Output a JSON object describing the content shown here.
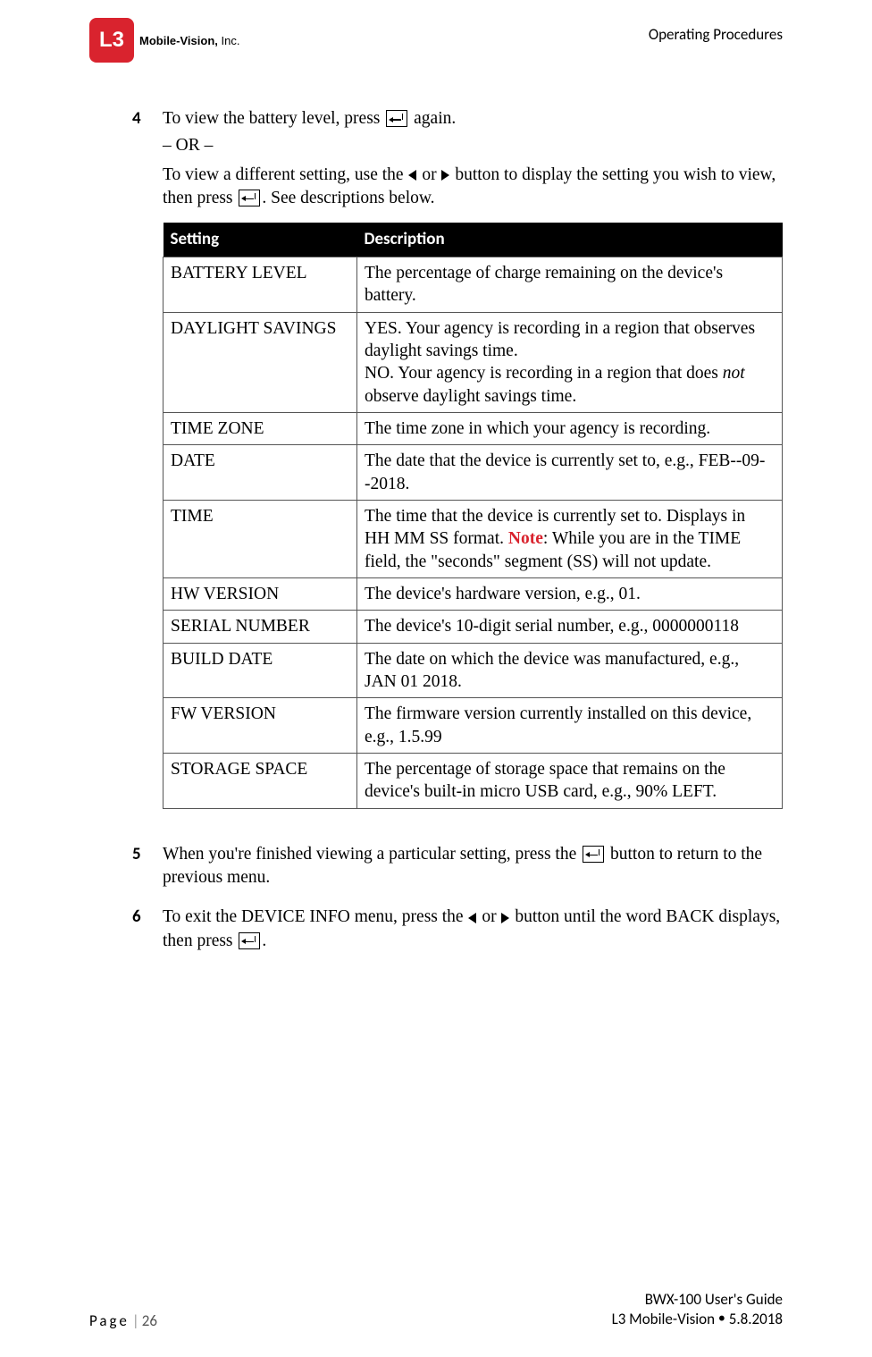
{
  "header": {
    "logo_badge": "L3",
    "logo_company_bold": "Mobile-Vision,",
    "logo_company_sfx": " Inc.",
    "section_title": "Operating Procedures"
  },
  "steps": {
    "s4": {
      "num": "4",
      "line1_a": "To view the battery level, press ",
      "line1_b": " again.",
      "or": "– OR –",
      "line2_a": "To view a different setting, use the ",
      "line2_mid": " or ",
      "line2_b": " button to display the setting you wish to view, then press ",
      "line2_c": ". See descriptions below."
    },
    "s5": {
      "num": "5",
      "text_a": "When you're finished viewing a particular setting, press the ",
      "text_b": " button to return to the previous menu."
    },
    "s6": {
      "num": "6",
      "text_a": "To exit the DEVICE INFO menu, press the ",
      "text_mid": " or ",
      "text_b": " button until the word BACK displays, then press ",
      "text_c": "."
    }
  },
  "table": {
    "col1": "Setting",
    "col2": "Description",
    "rows": [
      {
        "setting": "BATTERY LEVEL",
        "desc_plain": "The percentage of charge remaining on the device's battery."
      },
      {
        "setting": "DAYLIGHT SAVINGS",
        "desc_pre": "YES. Your agency is recording in a region that observes daylight savings time.\nNO. Your agency is recording in a region that does ",
        "desc_em": "not",
        "desc_post": " observe daylight savings time."
      },
      {
        "setting": "TIME ZONE",
        "desc_plain": "The time zone in which your agency is recording."
      },
      {
        "setting": "DATE",
        "desc_plain": "The date that the device is currently set to, e.g., FEB--09--2018."
      },
      {
        "setting": "TIME",
        "desc_pre": "The time that the device is currently set to. Displays in HH MM SS format. ",
        "note": "Note",
        "desc_post": ": While you are in the TIME field, the \"seconds\" segment (SS) will not update."
      },
      {
        "setting": "HW VERSION",
        "desc_plain": "The device's hardware version, e.g., 01."
      },
      {
        "setting": "SERIAL NUMBER",
        "desc_plain": "The device's 10-digit serial number, e.g., 0000000118"
      },
      {
        "setting": "BUILD DATE",
        "desc_plain": "The date on which the device was manufactured, e.g., JAN 01 2018."
      },
      {
        "setting": "FW VERSION",
        "desc_plain": "The firmware version currently installed on this device, e.g., 1.5.99"
      },
      {
        "setting": "STORAGE SPACE",
        "desc_plain": "The percentage of storage space that remains on the device's built-in micro USB card, e.g., 90% LEFT."
      }
    ]
  },
  "footer": {
    "page_label": "Page",
    "page_num": "26",
    "doc_title": "BWX-100 User's Guide",
    "org": "L3 Mobile-Vision ",
    "date": " 5.8.2018"
  }
}
